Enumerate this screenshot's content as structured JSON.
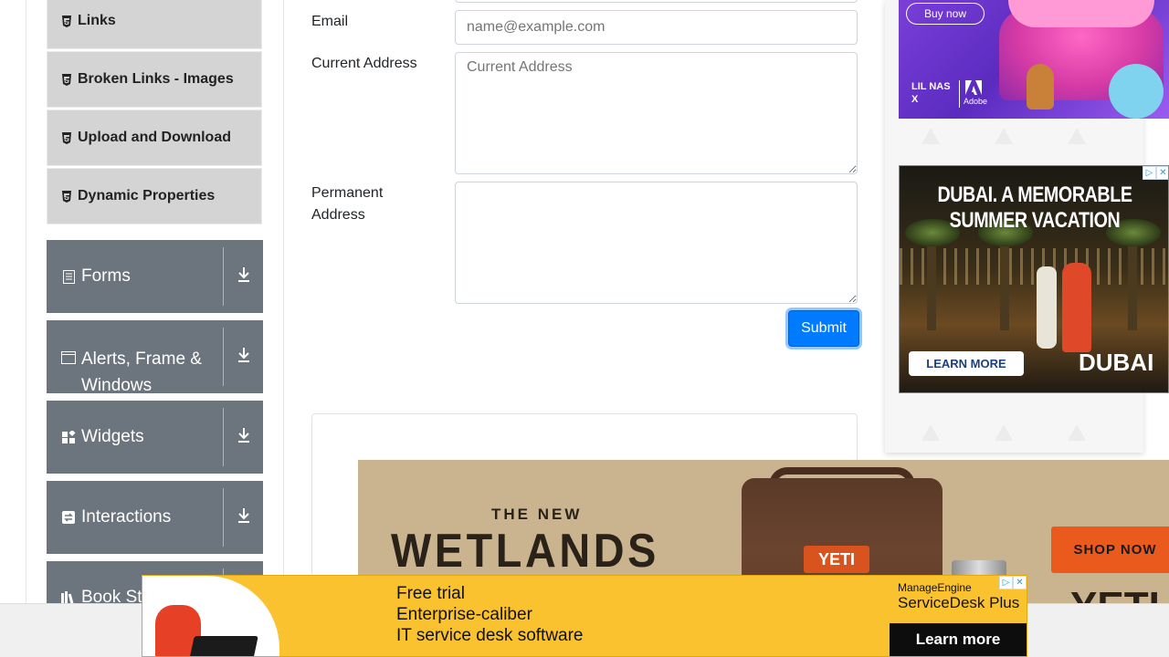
{
  "sidebar": {
    "sub_items": [
      {
        "label": "Links",
        "icon": "html5-icon"
      },
      {
        "label": "Broken Links - Images",
        "icon": "html5-icon"
      },
      {
        "label": "Upload and Download",
        "icon": "html5-icon"
      },
      {
        "label": "Dynamic Properties",
        "icon": "html5-icon"
      }
    ],
    "groups": [
      {
        "label": "Forms",
        "icon": "form-icon"
      },
      {
        "label": "Alerts, Frame &",
        "label2": "Windows",
        "icon": "window-icon"
      },
      {
        "label": "Widgets",
        "icon": "widgets-icon"
      },
      {
        "label": "Interactions",
        "icon": "interactions-icon"
      },
      {
        "label": "Book Store",
        "icon": "book-icon"
      }
    ]
  },
  "form": {
    "email_label": "Email",
    "email_placeholder": "name@example.com",
    "current_address_label": "Current Address",
    "current_address_placeholder": "Current Address",
    "permanent_address_label_line1": "Permanent",
    "permanent_address_label_line2": "Address",
    "submit_label": "Submit"
  },
  "ads": {
    "cake": {
      "buy_now": "Buy now",
      "brand1": "LIL NAS X",
      "brand2": "Adobe"
    },
    "dubai": {
      "title_line1": "DUBAI. A MEMORABLE",
      "title_line2": "SUMMER VACATION",
      "cta": "LEARN MORE",
      "logo": "DUBAI"
    },
    "yeti": {
      "the_new": "THE NEW",
      "product": "WETLANDS",
      "tag": "YETI",
      "cta": "SHOP NOW",
      "brand": "YETI"
    },
    "manage_engine": {
      "line1": "Free trial",
      "line2": "Enterprise-caliber",
      "line3": "IT service desk software",
      "brand1": "ManageEngine",
      "brand2": "ServiceDesk Plus",
      "cta": "Learn more"
    }
  },
  "colors": {
    "accent": "#007bff",
    "group_bg": "#6c757d",
    "sub_item_bg": "#d4d4d4"
  }
}
